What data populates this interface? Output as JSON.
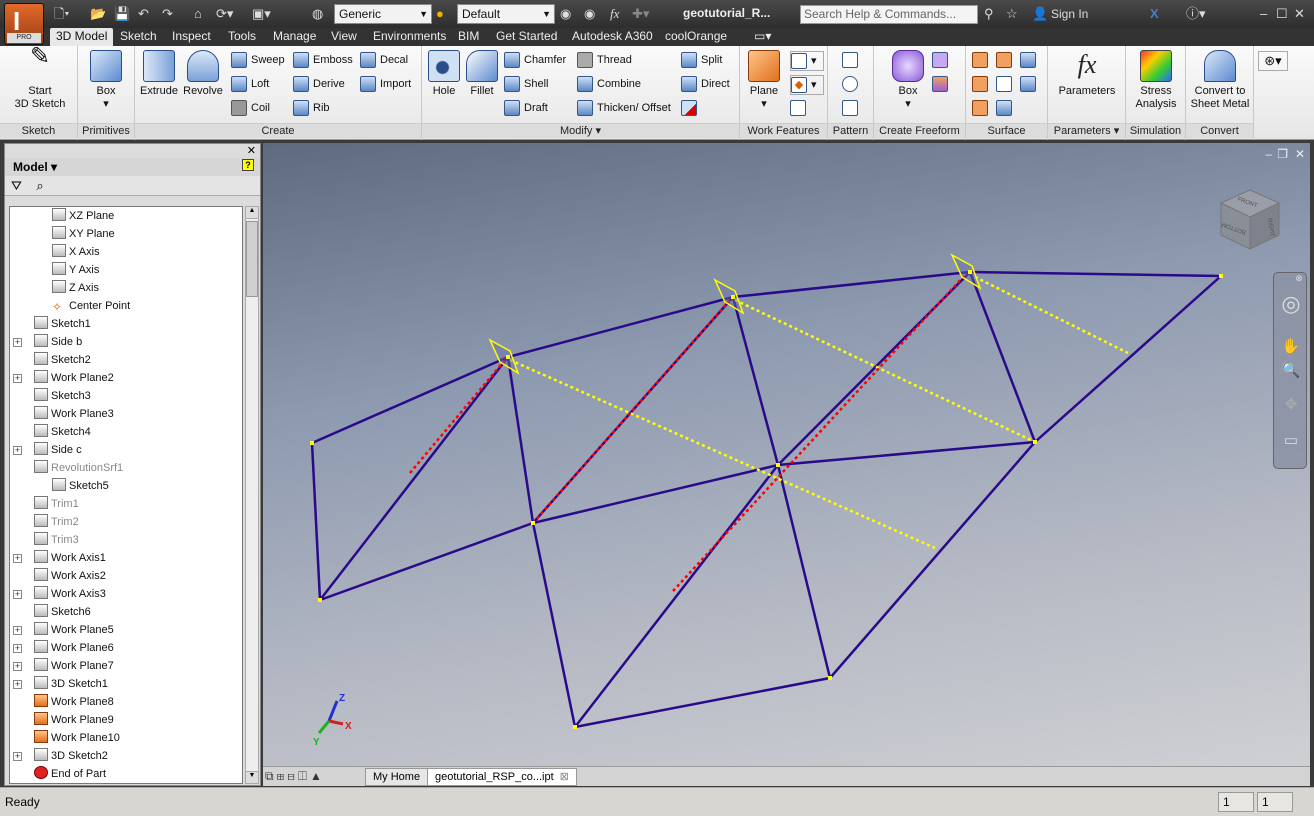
{
  "app": {
    "logo_letter": "I",
    "edition": "PRO",
    "doc_title": "geotutorial_R...",
    "search_placeholder": "Search Help & Commands...",
    "sign_in": "Sign In"
  },
  "quick_access": {
    "material": "Generic",
    "appearance": "Default",
    "fx": "fx"
  },
  "tabs": [
    {
      "label": "3D Model",
      "active": true
    },
    {
      "label": "Sketch"
    },
    {
      "label": "Inspect"
    },
    {
      "label": "Tools"
    },
    {
      "label": "Manage"
    },
    {
      "label": "View"
    },
    {
      "label": "Environments"
    },
    {
      "label": "BIM"
    },
    {
      "label": "Get Started"
    },
    {
      "label": "Autodesk A360"
    },
    {
      "label": "coolOrange"
    }
  ],
  "ribbon": {
    "sketch": {
      "label": "Sketch",
      "start": "Start\n3D Sketch"
    },
    "primitives": {
      "label": "Primitives",
      "box": "Box"
    },
    "create": {
      "label": "Create",
      "extrude": "Extrude",
      "revolve": "Revolve",
      "sweep": "Sweep",
      "loft": "Loft",
      "coil": "Coil",
      "emboss": "Emboss",
      "derive": "Derive",
      "rib": "Rib",
      "decal": "Decal",
      "import": "Import"
    },
    "modify": {
      "label": "Modify ▾",
      "hole": "Hole",
      "fillet": "Fillet",
      "chamfer": "Chamfer",
      "shell": "Shell",
      "draft": "Draft",
      "thread": "Thread",
      "combine": "Combine",
      "thicken": "Thicken/ Offset",
      "split": "Split",
      "direct": "Direct"
    },
    "work_features": {
      "label": "Work Features",
      "plane": "Plane"
    },
    "pattern": {
      "label": "Pattern"
    },
    "freeform": {
      "label": "Create Freeform",
      "box": "Box"
    },
    "surface": {
      "label": "Surface"
    },
    "parameters": {
      "label": "Parameters ▾",
      "btn": "Parameters"
    },
    "simulation": {
      "label": "Simulation",
      "btn": "Stress\nAnalysis"
    },
    "convert": {
      "label": "Convert",
      "btn": "Convert to\nSheet Metal"
    }
  },
  "browser": {
    "title": "Model ▾",
    "items": [
      {
        "label": "XZ Plane",
        "indent": 2,
        "icon": "plane"
      },
      {
        "label": "XY Plane",
        "indent": 2,
        "icon": "plane"
      },
      {
        "label": "X Axis",
        "indent": 2,
        "icon": "axis"
      },
      {
        "label": "Y Axis",
        "indent": 2,
        "icon": "axis"
      },
      {
        "label": "Z Axis",
        "indent": 2,
        "icon": "axis"
      },
      {
        "label": "Center Point",
        "indent": 2,
        "icon": "point"
      },
      {
        "label": "Sketch1",
        "indent": 1,
        "icon": "sketch"
      },
      {
        "label": "Side b",
        "indent": 1,
        "icon": "plane",
        "expand": true
      },
      {
        "label": "Sketch2",
        "indent": 1,
        "icon": "sketch"
      },
      {
        "label": "Work Plane2",
        "indent": 1,
        "icon": "plane",
        "expand": true
      },
      {
        "label": "Sketch3",
        "indent": 1,
        "icon": "sketch"
      },
      {
        "label": "Work Plane3",
        "indent": 1,
        "icon": "plane"
      },
      {
        "label": "Sketch4",
        "indent": 1,
        "icon": "sketch"
      },
      {
        "label": "Side c",
        "indent": 1,
        "icon": "plane",
        "expand": true
      },
      {
        "label": "RevolutionSrf1",
        "indent": 1,
        "icon": "revolve",
        "gray": true
      },
      {
        "label": "Sketch5",
        "indent": 2,
        "icon": "sketch"
      },
      {
        "label": "Trim1",
        "indent": 1,
        "icon": "trim",
        "gray": true
      },
      {
        "label": "Trim2",
        "indent": 1,
        "icon": "trim",
        "gray": true
      },
      {
        "label": "Trim3",
        "indent": 1,
        "icon": "trim",
        "gray": true
      },
      {
        "label": "Work Axis1",
        "indent": 1,
        "icon": "axis",
        "expand": true
      },
      {
        "label": "Work Axis2",
        "indent": 1,
        "icon": "axis"
      },
      {
        "label": "Work Axis3",
        "indent": 1,
        "icon": "axis",
        "expand": true
      },
      {
        "label": "Sketch6",
        "indent": 1,
        "icon": "sketch"
      },
      {
        "label": "Work Plane5",
        "indent": 1,
        "icon": "plane",
        "expand": true
      },
      {
        "label": "Work Plane6",
        "indent": 1,
        "icon": "plane",
        "expand": true
      },
      {
        "label": "Work Plane7",
        "indent": 1,
        "icon": "plane",
        "expand": true
      },
      {
        "label": "3D Sketch1",
        "indent": 1,
        "icon": "sketch3d",
        "expand": true
      },
      {
        "label": "Work Plane8",
        "indent": 1,
        "icon": "orange"
      },
      {
        "label": "Work Plane9",
        "indent": 1,
        "icon": "orange"
      },
      {
        "label": "Work Plane10",
        "indent": 1,
        "icon": "orange"
      },
      {
        "label": "3D Sketch2",
        "indent": 1,
        "icon": "sketch3d",
        "expand": true
      },
      {
        "label": "End of Part",
        "indent": 1,
        "icon": "end"
      }
    ]
  },
  "viewcube": {
    "faces": [
      "FRONT",
      "RIGHT",
      "BOTTOM"
    ]
  },
  "triad": {
    "x": "X",
    "y": "Y",
    "z": "Z"
  },
  "doc_tabs": [
    {
      "label": "My Home"
    },
    {
      "label": "geotutorial_RSP_co...ipt",
      "active": true,
      "close": "⊠"
    }
  ],
  "status": {
    "text": "Ready",
    "field1": "1",
    "field2": "1"
  },
  "colors": {
    "edges": "#2a0a8a",
    "constraint": "#ffff00",
    "axis": "#ff0000",
    "accent": "#e36a2a"
  }
}
